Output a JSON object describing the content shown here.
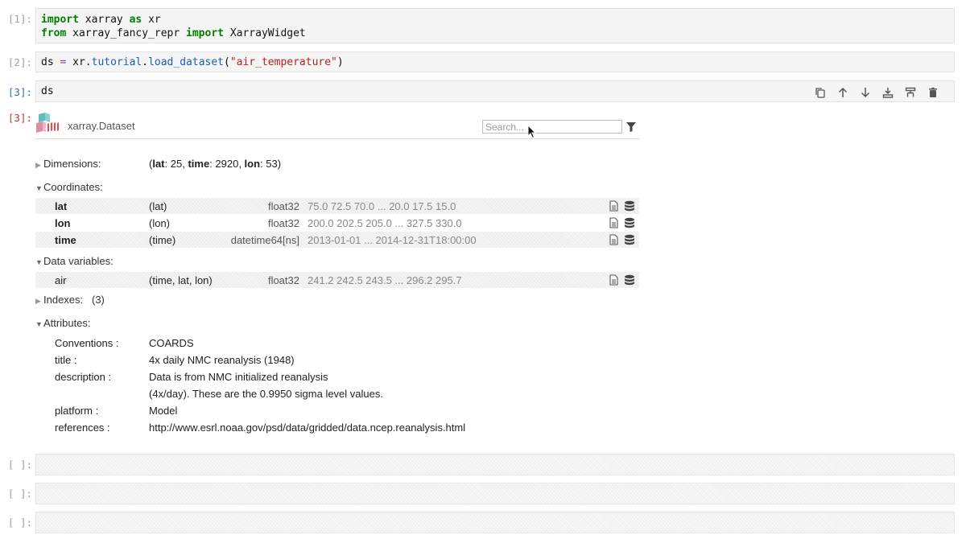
{
  "cells": [
    {
      "prompt": "[1]:",
      "lines": [
        "import xarray as xr",
        "from xarray_fancy_repr import XarrayWidget"
      ]
    },
    {
      "prompt": "[2]:",
      "line": "ds = xr.tutorial.load_dataset(\"air_temperature\")"
    },
    {
      "prompt": "[3]:",
      "line": "ds"
    }
  ],
  "code": {
    "kw_import": "import",
    "kw_as": "as",
    "kw_from": "from",
    "mod_xarray": " xarray ",
    "alias_xr": " xr",
    "mod_fancy": " xarray_fancy_repr ",
    "cls_widget": " XarrayWidget",
    "ds": "ds ",
    "eq": "=",
    "xr": " xr.",
    "tutorial": "tutorial",
    "dot": ".",
    "load": "load_dataset",
    "open_paren": "(",
    "arg": "\"air_temperature\"",
    "close_paren": ")",
    "ds_only": "ds"
  },
  "output_prompt": "[3]:",
  "widget": {
    "title": "xarray.Dataset",
    "search_placeholder": "Search...",
    "sections": {
      "dimensions": "Dimensions:",
      "coordinates": "Coordinates:",
      "data_variables": "Data variables:",
      "indexes": "Indexes:",
      "indexes_count": "(3)",
      "attributes": "Attributes:"
    },
    "dimensions": {
      "open": "(",
      "lat_key": "lat",
      "lat_val": ": 25, ",
      "time_key": "time",
      "time_val": ": 2920, ",
      "lon_key": "lon",
      "lon_val": ": 53)"
    },
    "coordinates": [
      {
        "name": "lat",
        "dims": "(lat)",
        "dtype": "float32",
        "preview": "75.0 72.5 70.0 ... 20.0 17.5 15.0"
      },
      {
        "name": "lon",
        "dims": "(lon)",
        "dtype": "float32",
        "preview": "200.0 202.5 205.0 ... 327.5 330.0"
      },
      {
        "name": "time",
        "dims": "(time)",
        "dtype": "datetime64[ns]",
        "preview": "2013-01-01 ... 2014-12-31T18:00:00"
      }
    ],
    "data_variables": [
      {
        "name": "air",
        "dims": "(time, lat, lon)",
        "dtype": "float32",
        "preview": "241.2 242.5 243.5 ... 296.2 295.7"
      }
    ],
    "attributes": [
      {
        "key": "Conventions :",
        "value": "COARDS"
      },
      {
        "key": "title :",
        "value": "4x daily NMC reanalysis (1948)"
      },
      {
        "key": "description :",
        "value": "Data is from NMC initialized reanalysis",
        "value2": "(4x/day).  These are the 0.9950 sigma level values."
      },
      {
        "key": "platform :",
        "value": "Model"
      },
      {
        "key": "references :",
        "value": "http://www.esrl.noaa.gov/psd/data/gridded/data.ncep.reanalysis.html"
      }
    ]
  },
  "empty_cells": [
    {
      "prompt": "[ ]:"
    },
    {
      "prompt": "[ ]:"
    },
    {
      "prompt": "[ ]:"
    }
  ],
  "icons": {
    "toolbar": [
      "copy-icon",
      "move-up-icon",
      "move-down-icon",
      "insert-below-icon",
      "format-icon",
      "trash-icon"
    ],
    "row": [
      "file-text-icon",
      "database-icon"
    ],
    "search_filter": "filter-icon"
  },
  "colors": {
    "keyword": "#008000",
    "string": "#ba2121",
    "active_prompt": "#2f6fb0",
    "output_prompt": "#c0392b"
  }
}
